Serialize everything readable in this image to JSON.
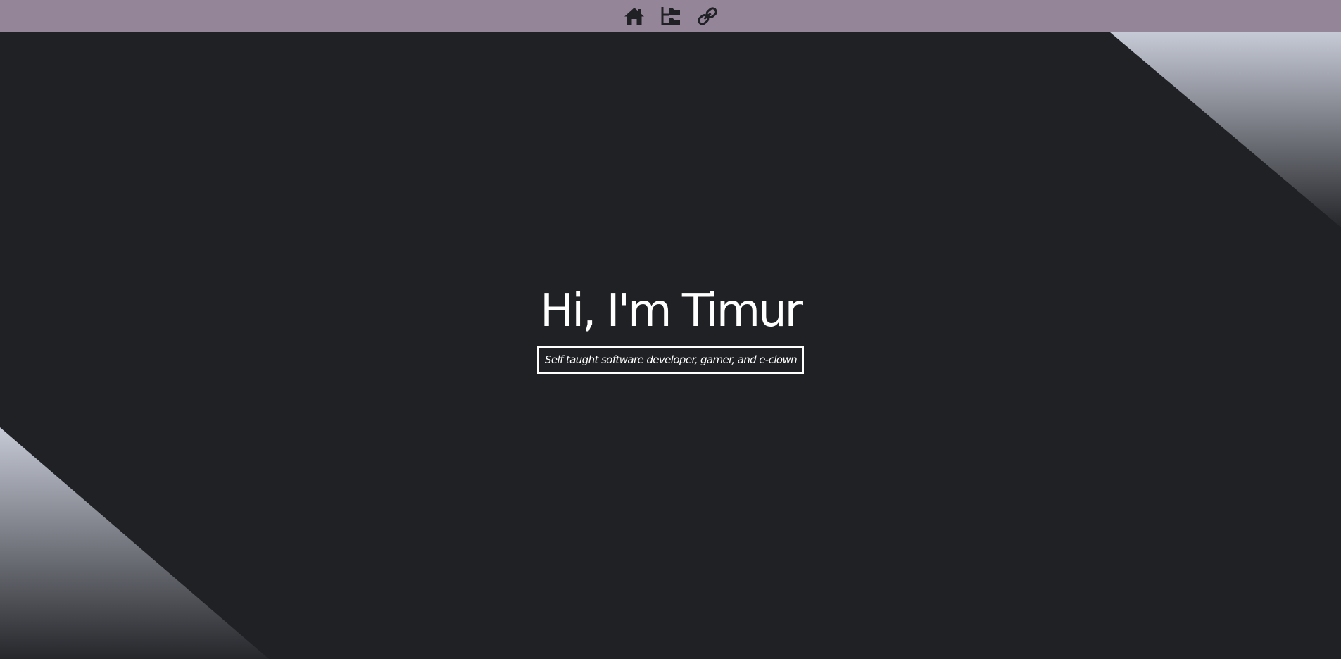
{
  "theme": {
    "navbar_bg": "#958599",
    "page_bg": "#202124",
    "icon_color": "#202124",
    "text_color": "#ffffff",
    "corner_light": "#c6cad6",
    "corner_dark": "#26272b"
  },
  "nav": {
    "items": [
      {
        "icon": "home-icon"
      },
      {
        "icon": "folder-tree-icon"
      },
      {
        "icon": "link-icon"
      }
    ]
  },
  "hero": {
    "title": "Hi, I'm Timur",
    "subtitle": "Self taught software developer, gamer, and e-clown"
  }
}
